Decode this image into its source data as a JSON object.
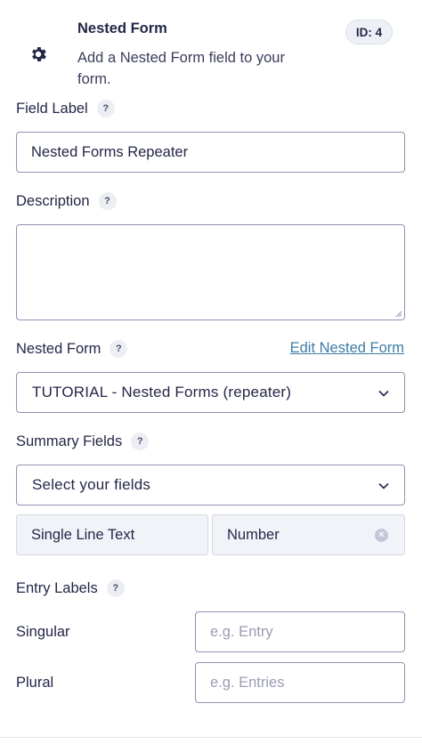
{
  "header": {
    "title": "Nested Form",
    "description": "Add a Nested Form field to your form.",
    "id_badge": "ID: 4",
    "icon": "gear-icon"
  },
  "field_label": {
    "label": "Field Label",
    "help": "?",
    "value": "Nested Forms Repeater"
  },
  "description": {
    "label": "Description",
    "help": "?",
    "value": ""
  },
  "nested_form": {
    "label": "Nested Form",
    "help": "?",
    "edit_link": "Edit Nested Form",
    "selected": "TUTORIAL - Nested Forms (repeater)"
  },
  "summary_fields": {
    "label": "Summary Fields",
    "help": "?",
    "placeholder": "Select your fields",
    "chips": [
      "Single Line Text",
      "Number"
    ]
  },
  "entry_labels": {
    "label": "Entry Labels",
    "help": "?",
    "singular_label": "Singular",
    "singular_placeholder": "e.g. Entry",
    "plural_label": "Plural",
    "plural_placeholder": "e.g. Entries"
  },
  "colors": {
    "accent": "#3e7da6",
    "text": "#242748",
    "border": "#9092b2",
    "chip_bg": "#f1f3f9"
  }
}
